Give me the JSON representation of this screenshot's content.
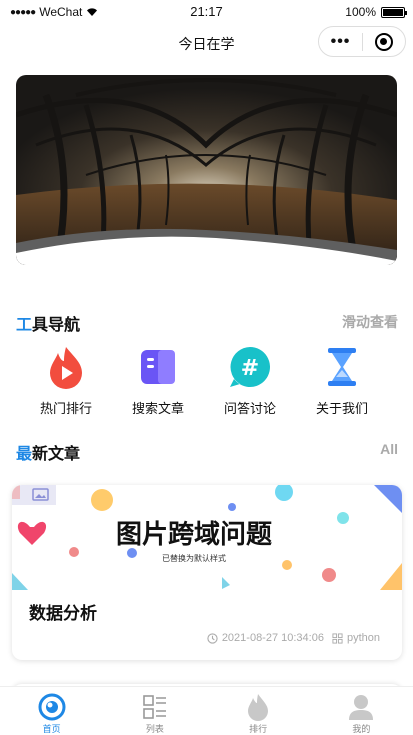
{
  "status_bar": {
    "carrier": "WeChat",
    "time": "21:17",
    "battery": "100%"
  },
  "nav": {
    "title": "今日在学",
    "more_icon": "ellipsis-icon",
    "close_icon": "target-icon"
  },
  "tools_section": {
    "title_first": "工",
    "title_rest": "具导航",
    "more": "滑动查看",
    "items": [
      {
        "label": "热门排行",
        "icon": "flame-play-icon",
        "color": "#f24d3e"
      },
      {
        "label": "搜索文章",
        "icon": "book-icon",
        "color": "#6a55f5"
      },
      {
        "label": "问答讨论",
        "icon": "hashtag-bubble-icon",
        "color": "#18c1c9"
      },
      {
        "label": "关于我们",
        "icon": "hourglass-icon",
        "color": "#2e7ff2"
      }
    ]
  },
  "articles_section": {
    "title_first": "最",
    "title_rest": "新文章",
    "more": "All"
  },
  "articles": [
    {
      "image_title": "图片跨域问题",
      "image_subtitle": "已替换为默认样式",
      "title": "数据分析",
      "datetime": "2021-08-27 10:34:06",
      "tag": "python"
    }
  ],
  "tab_bar": [
    {
      "label": "首页",
      "icon": "home-icon",
      "active": true
    },
    {
      "label": "列表",
      "icon": "list-icon",
      "active": false
    },
    {
      "label": "排行",
      "icon": "flame-icon",
      "active": false
    },
    {
      "label": "我的",
      "icon": "user-icon",
      "active": false
    }
  ],
  "colors": {
    "accent": "#1e88e5",
    "muted": "#aaaaaa"
  }
}
